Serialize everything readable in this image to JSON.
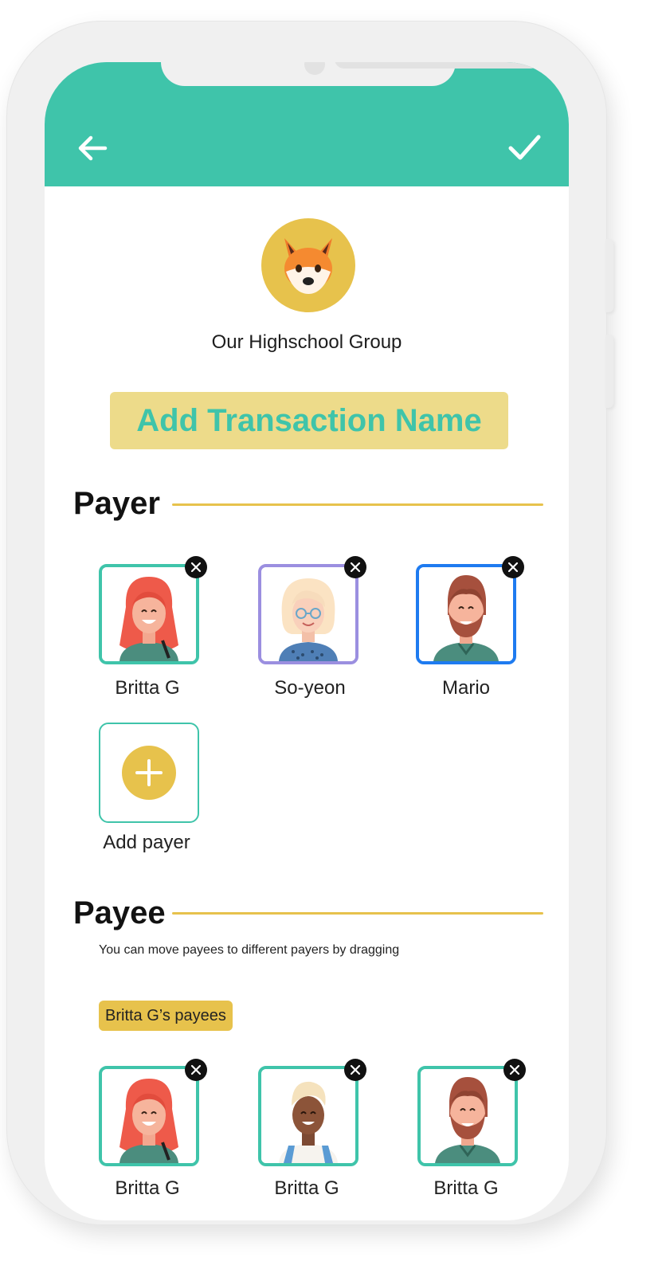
{
  "header": {
    "back_icon": "arrow-left-icon",
    "confirm_icon": "check-icon",
    "color": "#3fc4aa"
  },
  "group": {
    "avatar_icon": "fox-emoji",
    "name": "Our Highschool Group"
  },
  "transaction": {
    "name_placeholder": "Add Transaction Name"
  },
  "payer_section": {
    "title": "Payer",
    "payers": [
      {
        "name": "Britta G",
        "border_color": "#3fc4aa",
        "avatar": "woman-red-hair-avatar"
      },
      {
        "name": "So-yeon",
        "border_color": "#9b8fe0",
        "avatar": "woman-blonde-glasses-avatar"
      },
      {
        "name": "Mario",
        "border_color": "#1e7bf0",
        "avatar": "man-beard-avatar"
      }
    ],
    "add_label": "Add payer"
  },
  "payee_section": {
    "title": "Payee",
    "hint": "You can move payees to different payers by dragging",
    "group_label": "Britta G’s payees",
    "payees": [
      {
        "name": "Britta G",
        "avatar": "woman-red-hair-avatar"
      },
      {
        "name": "Britta G",
        "avatar": "man-blonde-hair-avatar"
      },
      {
        "name": "Britta G",
        "avatar": "man-beard-avatar"
      }
    ]
  },
  "colors": {
    "accent_teal": "#3fc4aa",
    "accent_yellow": "#e7c24c",
    "name_field_bg": "#eddb8a"
  }
}
